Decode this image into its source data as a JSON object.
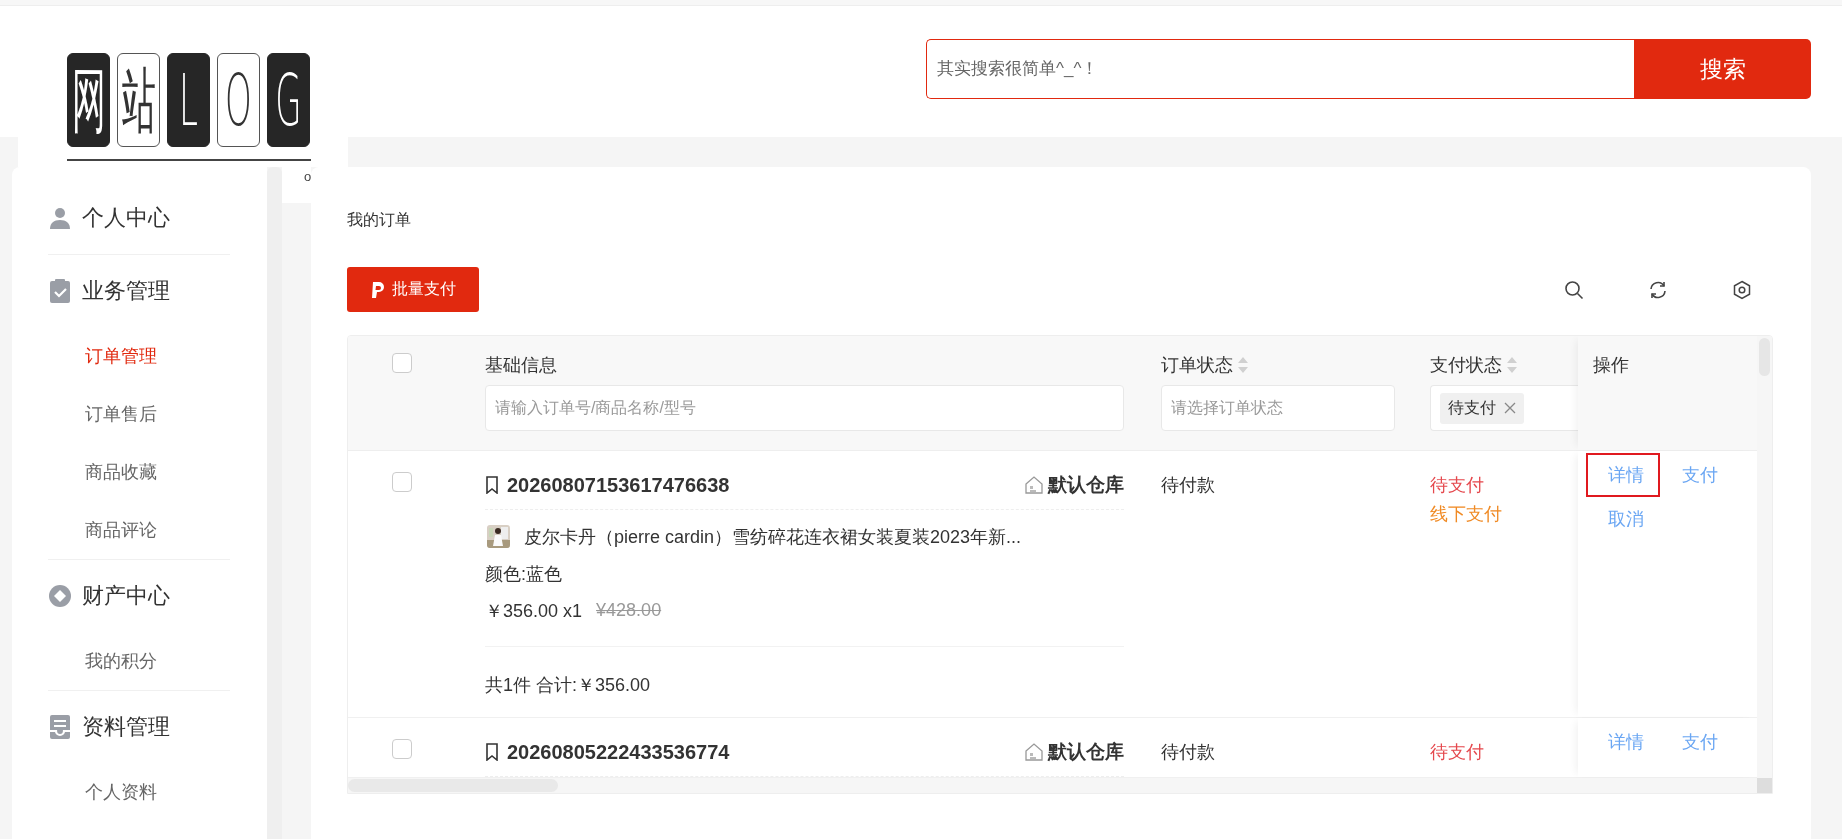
{
  "header": {
    "logo": {
      "tiles": [
        {
          "char": "网",
          "dark": true
        },
        {
          "char": "站",
          "dark": false
        },
        {
          "char": "L",
          "dark": true
        },
        {
          "char": "O",
          "dark": false
        },
        {
          "char": "G",
          "dark": true
        }
      ]
    },
    "search": {
      "placeholder": "其实搜索很简单^_^！",
      "button": "搜索"
    }
  },
  "caption": "o",
  "sidebar": {
    "groups": [
      {
        "title": "个人中心",
        "kind": "person"
      },
      {
        "title": "业务管理",
        "kind": "clipboard",
        "items": [
          {
            "label": "订单管理",
            "selected": true
          },
          {
            "label": "订单售后",
            "selected": false
          },
          {
            "label": "商品收藏",
            "selected": false
          },
          {
            "label": "商品评论",
            "selected": false
          }
        ]
      },
      {
        "title": "财产中心",
        "kind": "diamond",
        "items": [
          {
            "label": "我的积分",
            "selected": false
          }
        ]
      },
      {
        "title": "资料管理",
        "kind": "archive",
        "items": [
          {
            "label": "个人资料",
            "selected": false
          }
        ]
      }
    ]
  },
  "orders": {
    "title": "我的订单",
    "batch_button": "批量支付",
    "tools": [
      {
        "kind": "search"
      },
      {
        "kind": "refresh"
      },
      {
        "kind": "settings"
      }
    ],
    "table": {
      "select_all": {
        "checked": false
      },
      "columns": [
        {
          "title": "基础信息",
          "filter": {
            "kind": "input",
            "placeholder": "请输入订单号/商品名称/型号"
          }
        },
        {
          "title": "订单状态",
          "sortable": true,
          "filter": {
            "kind": "input",
            "placeholder": "请选择订单状态"
          }
        },
        {
          "title": "支付状态",
          "sortable": true,
          "filter": {
            "kind": "tags",
            "tags": [
              "待支付"
            ]
          }
        },
        {
          "title": "操作"
        }
      ],
      "rows": [
        {
          "selected": false,
          "order_no": "20260807153617476638",
          "warehouse": "默认仓库",
          "products": [
            {
              "name": "皮尔卡丹（pierre cardin）雪纺碎花连衣裙女装夏装2023年新...",
              "spec": "颜色:蓝色",
              "price": "￥356.00 x1",
              "original_price": "¥428.00"
            }
          ],
          "summary": "共1件 合计:￥356.00",
          "order_status": "待付款",
          "pay_status": "待支付",
          "pay_method": "线下支付",
          "actions": [
            {
              "label": "详情",
              "highlighted": true
            },
            {
              "label": "支付",
              "highlighted": false
            },
            {
              "label": "取消",
              "highlighted": false
            }
          ]
        },
        {
          "selected": false,
          "order_no": "20260805222433536774",
          "warehouse": "默认仓库",
          "order_status": "待付款",
          "pay_status": "待支付",
          "actions": [
            {
              "label": "详情",
              "highlighted": false
            },
            {
              "label": "支付",
              "highlighted": false
            }
          ]
        }
      ]
    }
  }
}
